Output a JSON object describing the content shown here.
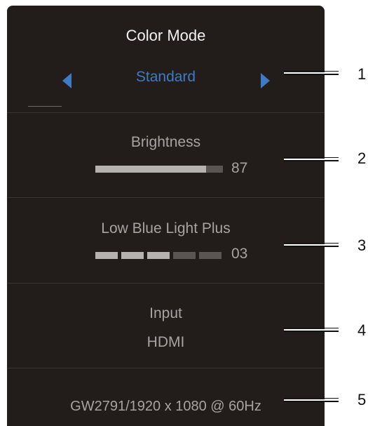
{
  "color_mode": {
    "title": "Color Mode",
    "value": "Standard"
  },
  "brightness": {
    "label": "Brightness",
    "value": "87",
    "level_percent": 87
  },
  "low_blue_light": {
    "label": "Low Blue Light Plus",
    "value": "03",
    "active_segments": 3,
    "total_segments": 5
  },
  "input": {
    "label": "Input",
    "value": "HDMI"
  },
  "footer": {
    "info": "GW2791/1920 x 1080 @ 60Hz"
  },
  "callouts": [
    "1",
    "2",
    "3",
    "4",
    "5"
  ],
  "colors": {
    "panel": "#221c1b",
    "accent": "#3e7bc4",
    "text": "#a8a3a1",
    "title": "#f2f2f2"
  },
  "icons": {
    "left_arrow": "triangle-left-icon",
    "right_arrow": "triangle-right-icon"
  }
}
